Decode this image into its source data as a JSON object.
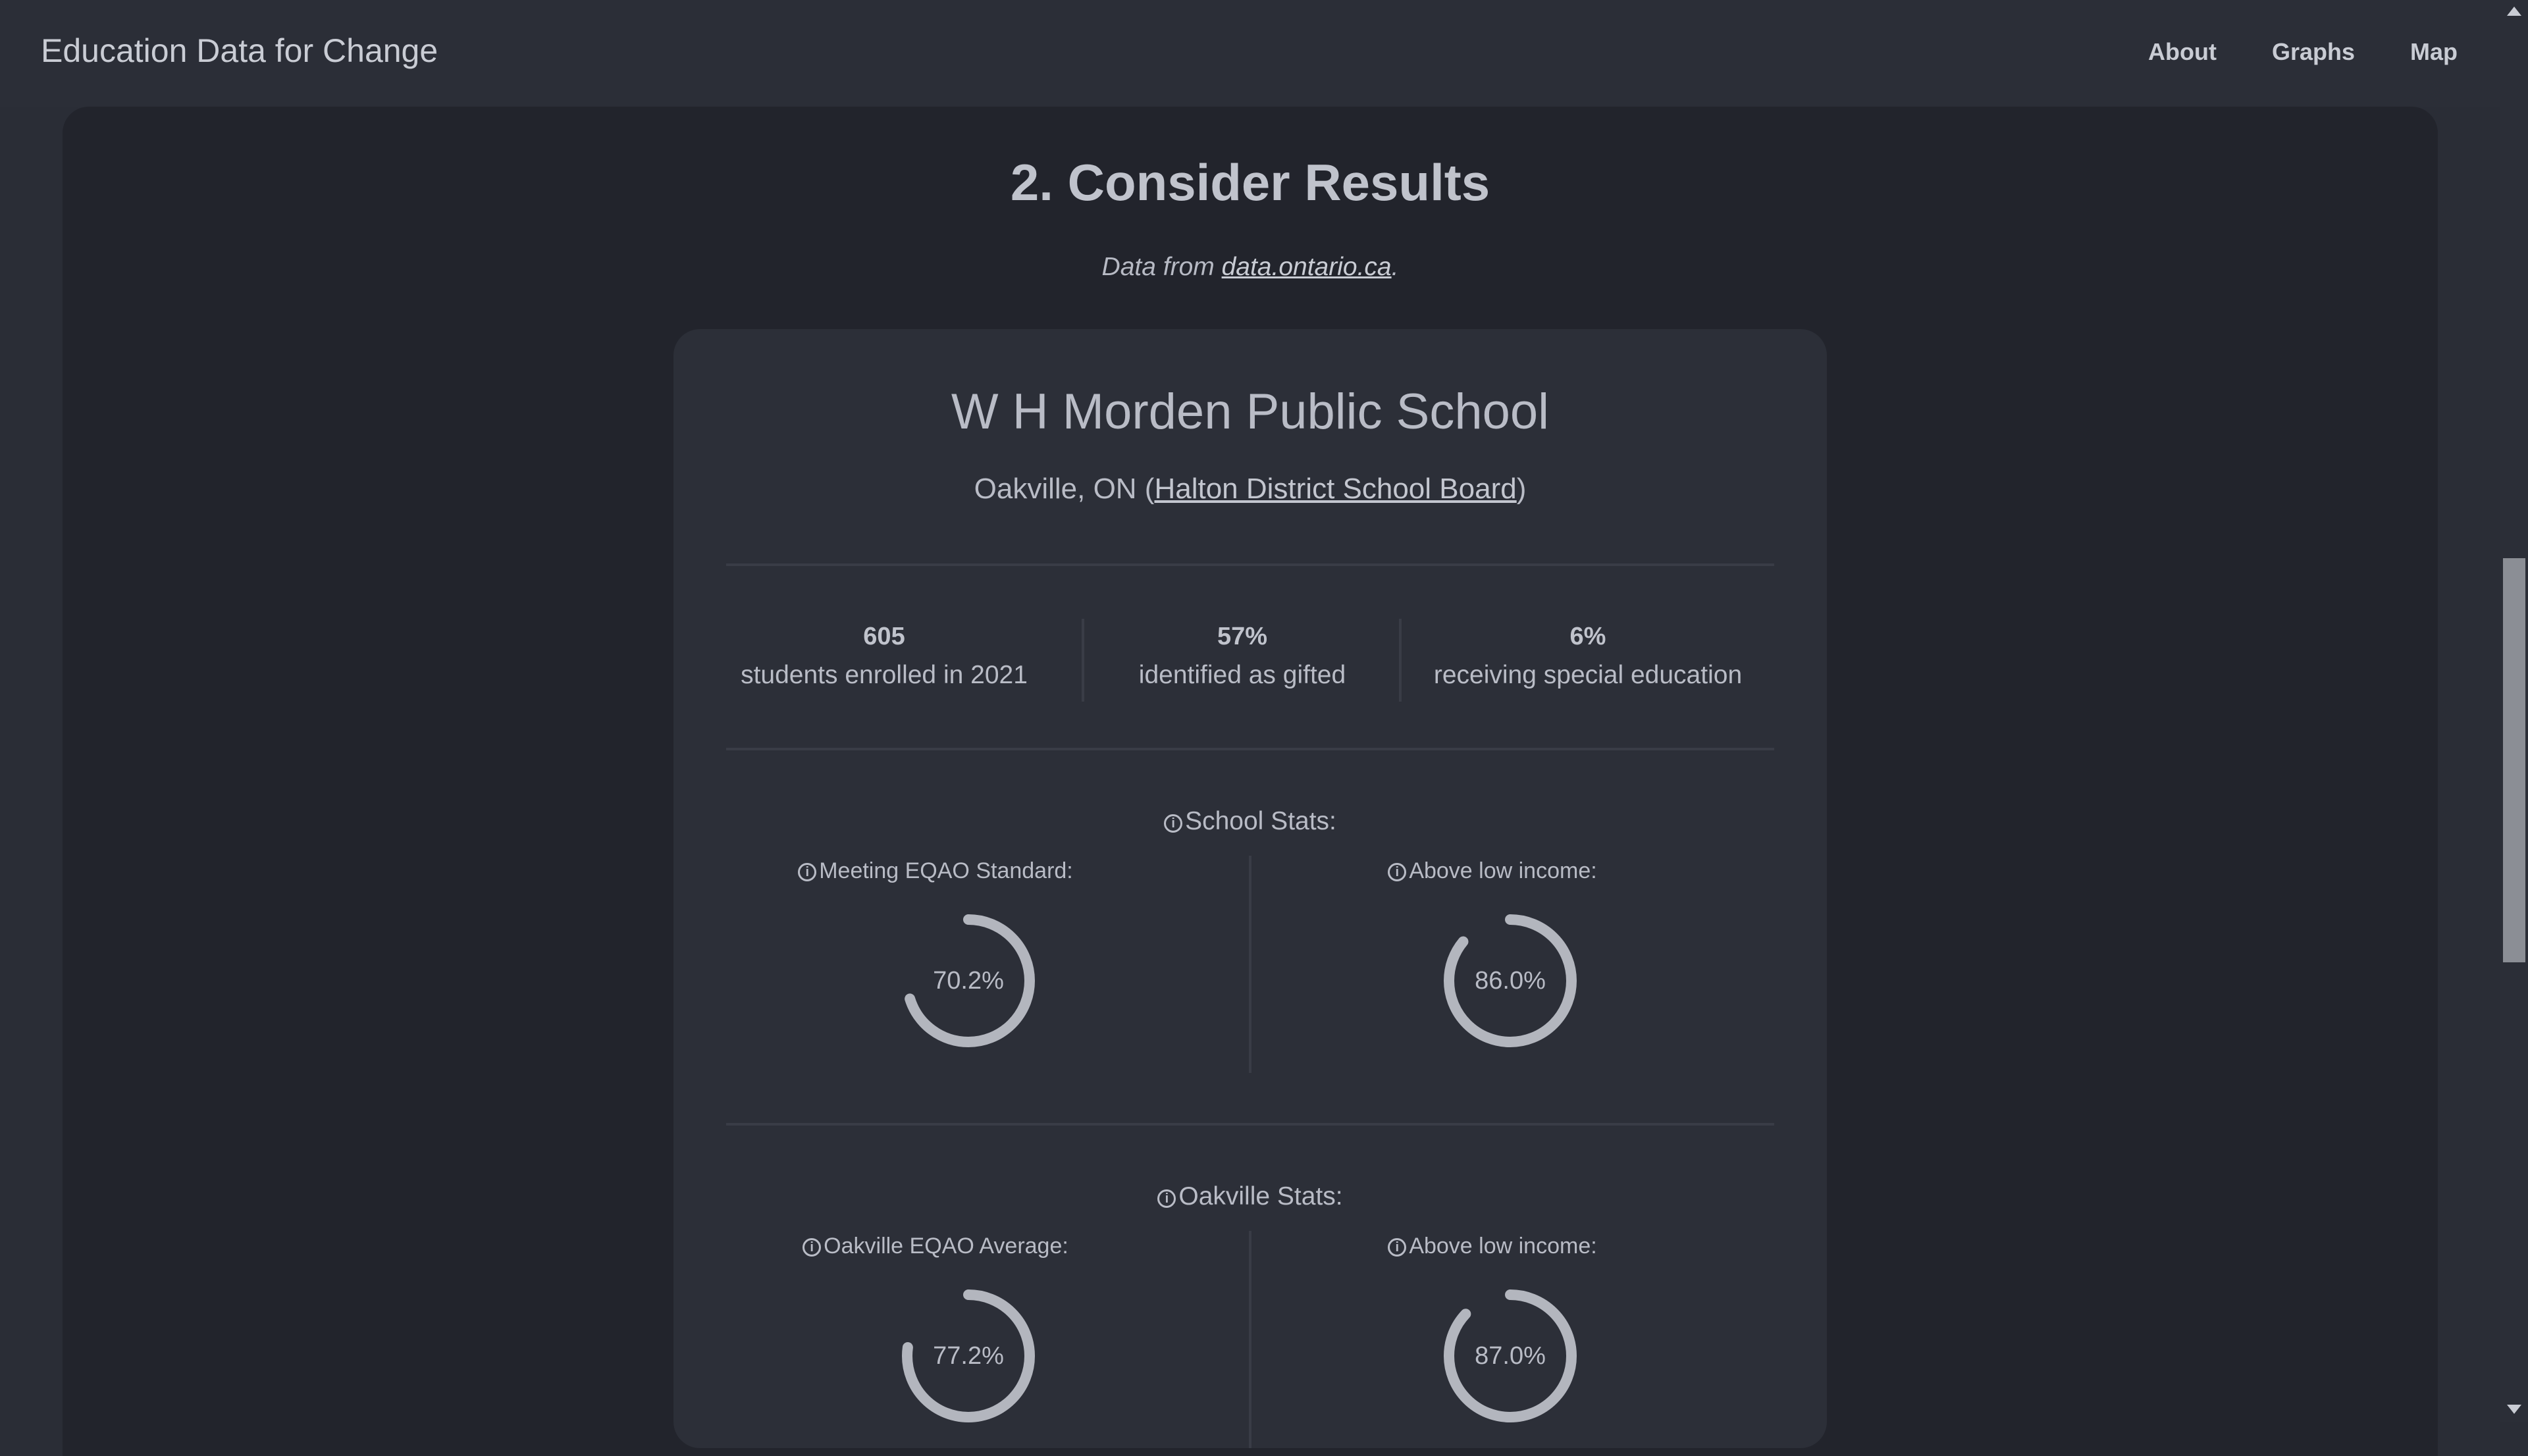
{
  "nav": {
    "brand": "Education Data for Change",
    "links": [
      "About",
      "Graphs",
      "Map"
    ]
  },
  "section": {
    "title": "2. Consider Results",
    "data_note_prefix": "Data from ",
    "data_link": "data.ontario.ca",
    "data_note_suffix": "."
  },
  "school": {
    "name": "W H Morden Public School",
    "location_prefix": "Oakville, ON (",
    "board": "Halton District School Board",
    "location_suffix": ")",
    "facts": [
      {
        "value": "605",
        "label": "students enrolled in 2021"
      },
      {
        "value": "57%",
        "label": "identified as gifted"
      },
      {
        "value": "6%",
        "label": "receiving special education"
      }
    ]
  },
  "school_stats": {
    "heading": "School Stats:",
    "items": [
      {
        "label": "Meeting EQAO Standard:",
        "display": "70.2%",
        "percent": 70.2
      },
      {
        "label": "Above low income:",
        "display": "86.0%",
        "percent": 86.0
      }
    ]
  },
  "city_stats": {
    "heading": "Oakville Stats:",
    "items": [
      {
        "label": "Oakville EQAO Average:",
        "display": "77.2%",
        "percent": 77.2
      },
      {
        "label": "Above low income:",
        "display": "87.0%",
        "percent": 87.0
      }
    ]
  },
  "icons": {
    "info": "info-circle-icon",
    "scroll_up": "arrow-up-icon",
    "scroll_down": "arrow-down-icon"
  },
  "colors": {
    "background": "#2a2d36",
    "section": "#22242c",
    "card": "#2c2f38",
    "ring": "#b3b6be"
  }
}
